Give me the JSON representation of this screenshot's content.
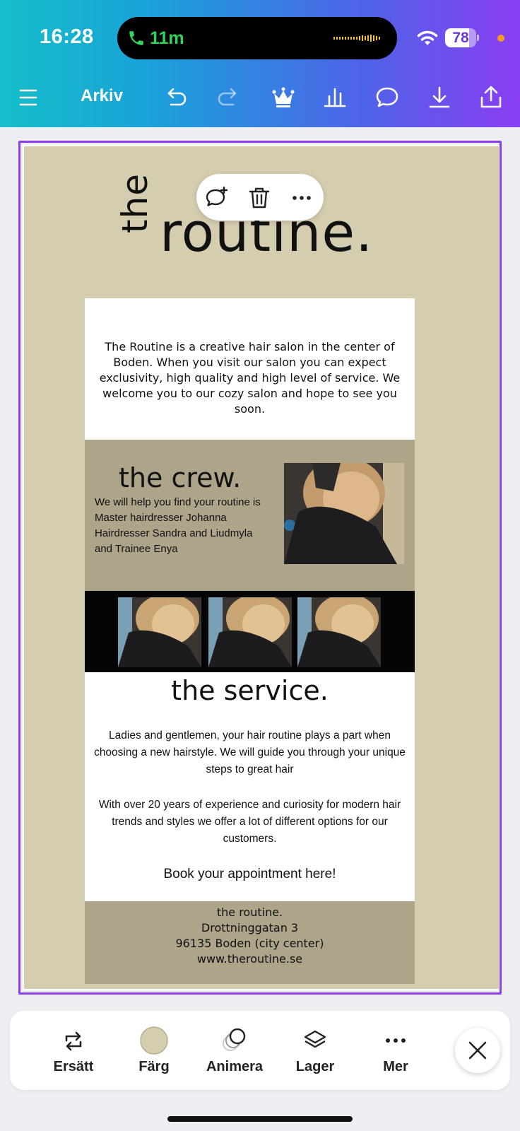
{
  "status": {
    "time": "16:28",
    "call_duration": "11m",
    "battery": "78",
    "battery_level": 0.78
  },
  "toolbar": {
    "file_label": "Arkiv",
    "icons": [
      "menu-icon",
      "undo-icon",
      "redo-icon",
      "crown-icon",
      "chart-icon",
      "comment-icon",
      "download-icon",
      "share-icon"
    ]
  },
  "popup": {
    "icons": [
      "add-comment-icon",
      "trash-icon",
      "more-icon"
    ]
  },
  "design": {
    "logo_the": "the",
    "logo_routine": "routine.",
    "intro": "The Routine is a creative hair salon in the center of Boden. When you visit our salon you can expect exclusivity, high quality and high level of service. We welcome you to our cozy salon and hope to see you soon.",
    "crew_title": "the crew.",
    "crew_lines": [
      "We will help you find your routine is",
      "Master hairdresser Johanna",
      "Hairdresser Sandra and Liudmyla",
      "and Trainee Enya"
    ],
    "service_title": "the service.",
    "service_p1": "Ladies and gentlemen, your hair routine plays a part when choosing a new hairstyle. We will guide you through your unique steps to great hair",
    "service_p2": "With over 20  years of experience and curiosity for modern hair trends and styles we offer a lot of different options for our customers.",
    "book": "Book your appointment here!",
    "footer": [
      "the routine.",
      "Drottninggatan 3",
      "96135 Boden (city center)",
      "www.theroutine.se"
    ]
  },
  "bottom_toolbar": {
    "items": [
      {
        "label": "Ersätt",
        "icon": "replace-icon"
      },
      {
        "label": "Färg",
        "icon": "color-swatch-icon",
        "color": "#d5cdb0"
      },
      {
        "label": "Animera",
        "icon": "animate-icon"
      },
      {
        "label": "Lager",
        "icon": "layers-icon"
      },
      {
        "label": "Mer",
        "icon": "more-icon"
      }
    ]
  },
  "colors": {
    "accent": "#8b3ff0",
    "page": "#d5cdb0",
    "band": "#ada48a"
  }
}
